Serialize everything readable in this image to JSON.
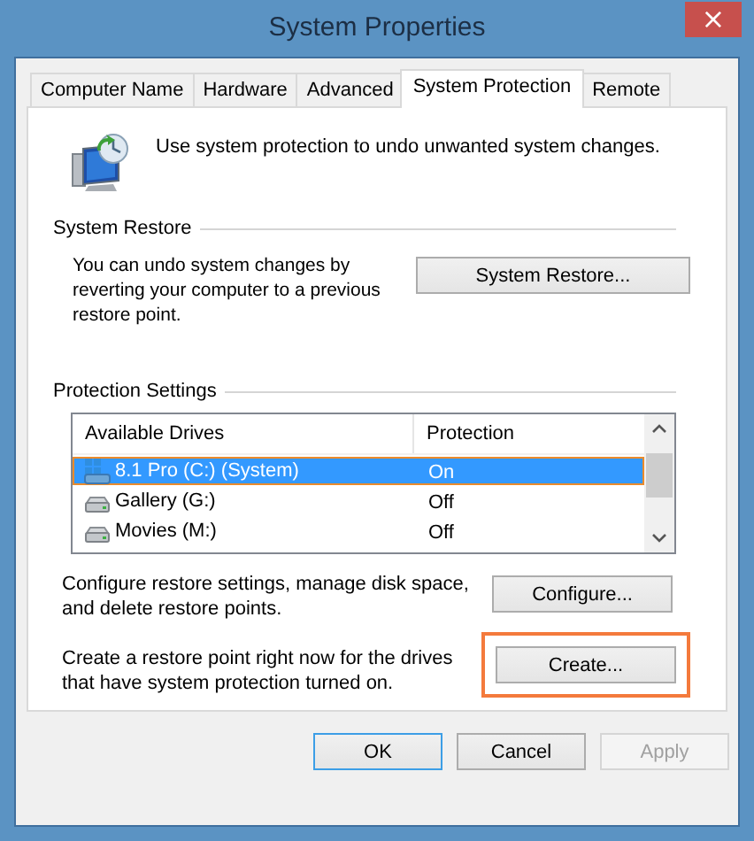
{
  "window": {
    "title": "System Properties",
    "close": "×"
  },
  "tabs": [
    {
      "label": "Computer Name",
      "selected": false
    },
    {
      "label": "Hardware",
      "selected": false
    },
    {
      "label": "Advanced",
      "selected": false
    },
    {
      "label": "System Protection",
      "selected": true
    },
    {
      "label": "Remote",
      "selected": false
    }
  ],
  "intro": "Use system protection to undo unwanted system changes.",
  "system_restore": {
    "heading": "System Restore",
    "text": "You can undo system changes by reverting your computer to a previous restore point.",
    "button": {
      "label": "System Restore...",
      "highlighted": false
    }
  },
  "protection_settings": {
    "heading": "Protection Settings",
    "columns": [
      "Available Drives",
      "Protection"
    ],
    "drives": [
      {
        "kind": "system",
        "name": "8.1 Pro (C:) (System)",
        "protection": "On",
        "selected": true
      },
      {
        "kind": "disk",
        "name": "Gallery (G:)",
        "protection": "Off",
        "selected": false
      },
      {
        "kind": "disk",
        "name": "Movies (M:)",
        "protection": "Off",
        "selected": false
      }
    ],
    "configure": {
      "text": "Configure restore settings, manage disk space, and delete restore points.",
      "button": {
        "label": "Configure...",
        "highlighted": false
      }
    },
    "create": {
      "text": "Create a restore point right now for the drives that have system protection turned on.",
      "button": {
        "label": "Create...",
        "highlighted": true
      }
    }
  },
  "buttons": [
    {
      "label": "OK",
      "default": true,
      "disabled": false
    },
    {
      "label": "Cancel",
      "default": false,
      "disabled": false
    },
    {
      "label": "Apply",
      "default": false,
      "disabled": true
    }
  ]
}
